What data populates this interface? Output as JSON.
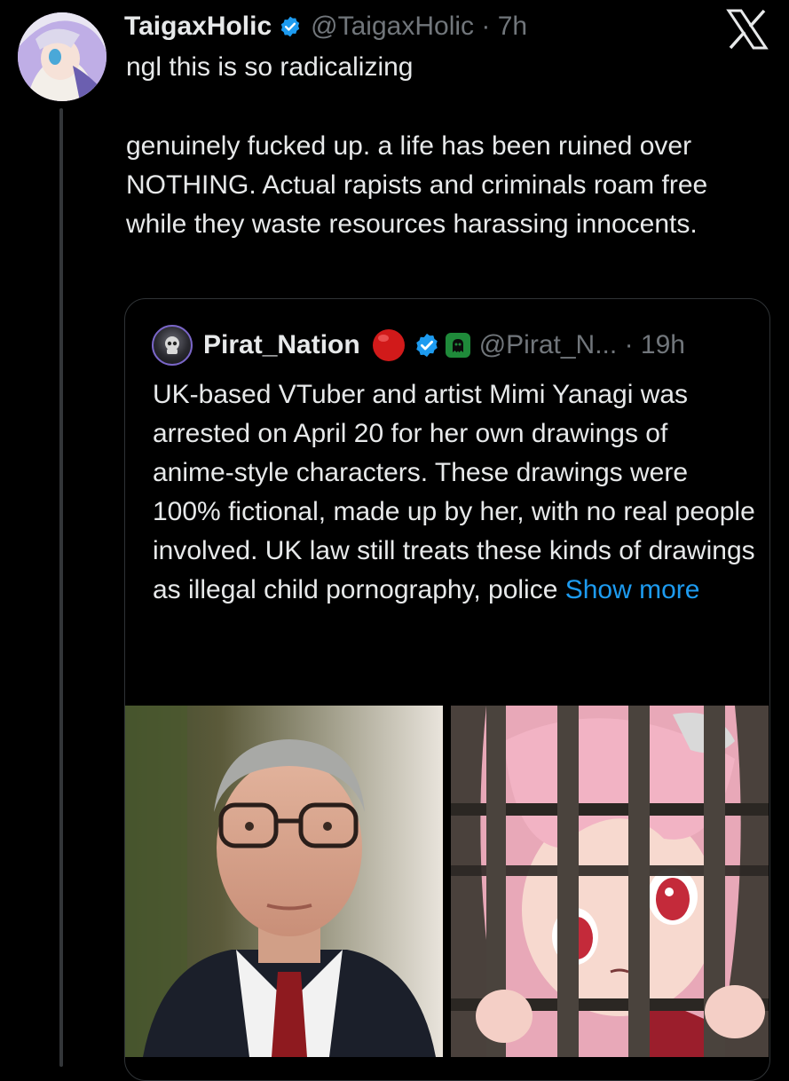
{
  "post": {
    "author_name": "TaigaxHolic",
    "handle": "@TaigaxHolic",
    "separator": "·",
    "time": "7h",
    "text_line": "ngl this is so radicalizing",
    "body_text": "genuinely fucked up. a life has been ruined over NOTHING. Actual rapists and criminals roam free while they waste resources harassing innocents."
  },
  "quote": {
    "author_name": "Pirat_Nation",
    "handle": "@Pirat_N...",
    "separator": "·",
    "time": "19h",
    "text": "UK-based VTuber and artist Mimi Yanagi was arrested on April 20 for her own drawings of anime-style characters. These drawings were 100% fictional, made up by her, with no real people involved. UK law still treats these kinds of drawings as illegal child pornography, police",
    "show_more": "Show more"
  },
  "icons": {
    "verified": "verified-badge-icon",
    "x_logo": "x-logo-icon",
    "red_circle": "red-circle-emoji-icon",
    "ghost": "ghost-badge-icon"
  },
  "colors": {
    "background": "#000000",
    "text": "#e7e9ea",
    "secondary_text": "#71767b",
    "link": "#1d9bf0",
    "verified": "#1d9bf0",
    "border": "#2f3336"
  }
}
